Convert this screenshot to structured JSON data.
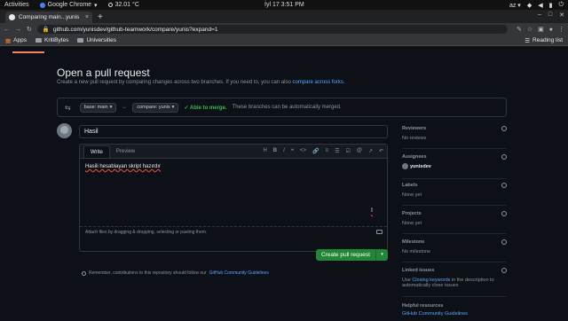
{
  "os": {
    "activities": "Activities",
    "app": "Google Chrome",
    "app_arrow": "▾",
    "temp": "32.01 °C",
    "clock": "İyl 17   3:51 PM",
    "lang": "az",
    "lang_arrow": "▾"
  },
  "browser": {
    "tab_title": "Comparing main...yunis",
    "tab_close": "×",
    "new_tab": "+",
    "url": "github.com/yunisdev/github-teamwork/compare/yunis?expand=1",
    "bookmarks": [
      {
        "label": "Apps"
      },
      {
        "label": "KritiBytes"
      },
      {
        "label": "Universities"
      }
    ],
    "reading_list": "Reading list"
  },
  "page": {
    "title": "Open a pull request",
    "description": "Create a new pull request by comparing changes across two branches. If you need to, you can also ",
    "description_link": "compare across forks",
    "description_end": ".",
    "base_label": "base: main",
    "compare_label": "compare: yunis",
    "merge_ok": "✓ Able to merge.",
    "merge_text": "These branches can be automatically merged.",
    "pr_title": "Hasil",
    "tabs": {
      "write": "Write",
      "preview": "Preview"
    },
    "toolbar": {
      "heading": "H",
      "bold": "B",
      "italic": "I",
      "quote": "❝",
      "code": "<>",
      "link": "🔗",
      "ul": "≡",
      "ol": "☰",
      "task": "☑",
      "mention": "@",
      "ref": "↗",
      "reply": "↶"
    },
    "body_text": "Hasili hesablayan skript hazırdır",
    "attach_text": "Attach files by dragging & dropping, selecting or pasting them.",
    "create_button": "Create pull request",
    "create_drop": "▾",
    "remember_text": "Remember, contributions to this repository should follow our",
    "remember_link": "GitHub Community Guidelines",
    "remember_end": "."
  },
  "sidebar": {
    "reviewers": {
      "head": "Reviewers",
      "val": "No reviews"
    },
    "assignees": {
      "head": "Assignees",
      "val": "yunisdev"
    },
    "labels": {
      "head": "Labels",
      "val": "None yet"
    },
    "projects": {
      "head": "Projects",
      "val": "None yet"
    },
    "milestone": {
      "head": "Milestone",
      "val": "No milestone"
    },
    "linked": {
      "head": "Linked issues",
      "val1": "Use ",
      "link": "Closing keywords",
      "val2": " in the description to automatically close issues"
    },
    "helpful": {
      "head": "Helpful resources",
      "link": "GitHub Community Guidelines"
    }
  }
}
